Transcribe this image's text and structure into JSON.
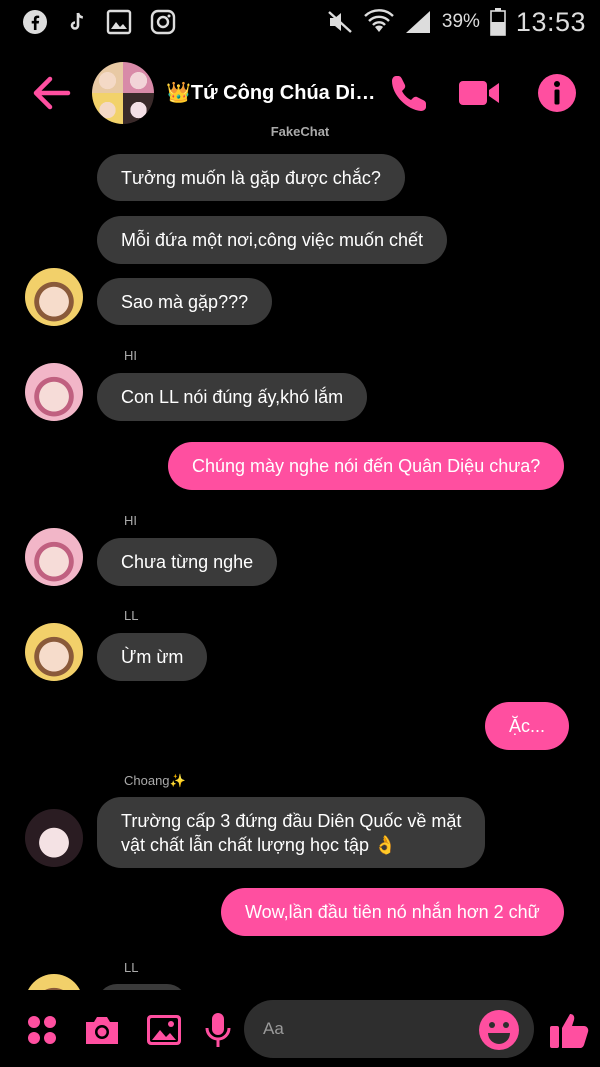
{
  "status_bar": {
    "battery_percent": "39%",
    "time": "13:53",
    "left_icons": [
      "facebook-icon",
      "tiktok-icon",
      "gallery-icon",
      "instagram-icon"
    ],
    "right_icons": [
      "mute-icon",
      "wifi-icon",
      "signal-icon",
      "battery-icon"
    ]
  },
  "header": {
    "title": "👑Tứ Công Chúa Diên Quốc",
    "subtitle": "FakeChat",
    "icons": [
      "back-arrow-icon",
      "phone-icon",
      "video-icon",
      "info-icon"
    ]
  },
  "messages": [
    {
      "side": "in",
      "text": "Tưởng muốn là gặp được chắc?"
    },
    {
      "side": "in",
      "text": "Mỗi đứa một nơi,công việc muốn chết"
    },
    {
      "side": "in",
      "text": "Sao mà gặp???"
    },
    {
      "side": "in",
      "sender": "HI",
      "text": "Con LL nói đúng ấy,khó lắm"
    },
    {
      "side": "out",
      "text": "Chúng mày nghe nói đến Quân Diệu chưa?"
    },
    {
      "side": "in",
      "sender": "HI",
      "text": "Chưa từng nghe"
    },
    {
      "side": "in",
      "sender": "LL",
      "text": "Ừm ừm"
    },
    {
      "side": "out",
      "text": "Ặc..."
    },
    {
      "side": "in",
      "sender": "Choang✨",
      "text_line1": "Trường cấp 3 đứng đầu Diên Quốc về mặt",
      "text_line2": "vật chất lẫn chất lượng học tập 👌"
    },
    {
      "side": "out",
      "text": "Wow,lần đầu tiên nó nhắn hơn 2 chữ"
    },
    {
      "side": "in",
      "sender": "LL"
    }
  ],
  "composer": {
    "placeholder": "Aa",
    "icons": [
      "menu-dots-icon",
      "camera-icon",
      "image-icon",
      "microphone-icon",
      "emoji-icon",
      "thumbs-up-icon"
    ]
  },
  "colors": {
    "accent": "#ff4fa0",
    "incoming_bubble": "#3a3a3a",
    "background": "#000000"
  }
}
